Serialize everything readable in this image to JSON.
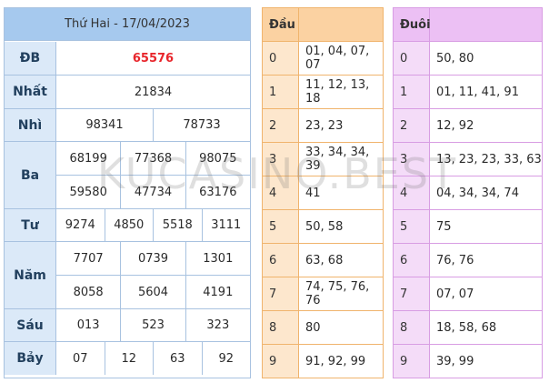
{
  "results": {
    "header": "Thứ Hai - 17/04/2023",
    "rows": [
      {
        "label": "ĐB",
        "lines": [
          [
            "65576"
          ]
        ]
      },
      {
        "label": "Nhất",
        "lines": [
          [
            "21834"
          ]
        ]
      },
      {
        "label": "Nhì",
        "lines": [
          [
            "98341",
            "78733"
          ]
        ]
      },
      {
        "label": "Ba",
        "lines": [
          [
            "68199",
            "77368",
            "98075"
          ],
          [
            "59580",
            "47734",
            "63176"
          ]
        ]
      },
      {
        "label": "Tư",
        "lines": [
          [
            "9274",
            "4850",
            "5518",
            "3111"
          ]
        ]
      },
      {
        "label": "Năm",
        "lines": [
          [
            "7707",
            "0739",
            "1301"
          ],
          [
            "8058",
            "5604",
            "4191"
          ]
        ]
      },
      {
        "label": "Sáu",
        "lines": [
          [
            "013",
            "523",
            "323"
          ]
        ]
      },
      {
        "label": "Bảy",
        "lines": [
          [
            "07",
            "12",
            "63",
            "92"
          ]
        ]
      }
    ]
  },
  "dau": {
    "header": "Đầu",
    "rows": [
      {
        "key": "0",
        "value": "01, 04, 07, 07"
      },
      {
        "key": "1",
        "value": "11, 12, 13, 18"
      },
      {
        "key": "2",
        "value": "23, 23"
      },
      {
        "key": "3",
        "value": "33, 34, 34, 39"
      },
      {
        "key": "4",
        "value": "41"
      },
      {
        "key": "5",
        "value": "50, 58"
      },
      {
        "key": "6",
        "value": "63, 68"
      },
      {
        "key": "7",
        "value": "74, 75, 76, 76"
      },
      {
        "key": "8",
        "value": "80"
      },
      {
        "key": "9",
        "value": "91, 92, 99"
      }
    ]
  },
  "duoi": {
    "header": "Đuôi",
    "rows": [
      {
        "key": "0",
        "value": "50, 80"
      },
      {
        "key": "1",
        "value": "01, 11, 41, 91"
      },
      {
        "key": "2",
        "value": "12, 92"
      },
      {
        "key": "3",
        "value": "13, 23, 23, 33, 63"
      },
      {
        "key": "4",
        "value": "04, 34, 34, 74"
      },
      {
        "key": "5",
        "value": "75"
      },
      {
        "key": "6",
        "value": "76, 76"
      },
      {
        "key": "7",
        "value": "07, 07"
      },
      {
        "key": "8",
        "value": "18, 58, 68"
      },
      {
        "key": "9",
        "value": "39, 99"
      }
    ]
  },
  "watermark": "KUCASINO.BEST",
  "colors": {
    "special_prize": "#e8262c",
    "results_accent": "#a6c9ee",
    "dau_accent": "#fbd2a2",
    "duoi_accent": "#ecc0f4"
  }
}
